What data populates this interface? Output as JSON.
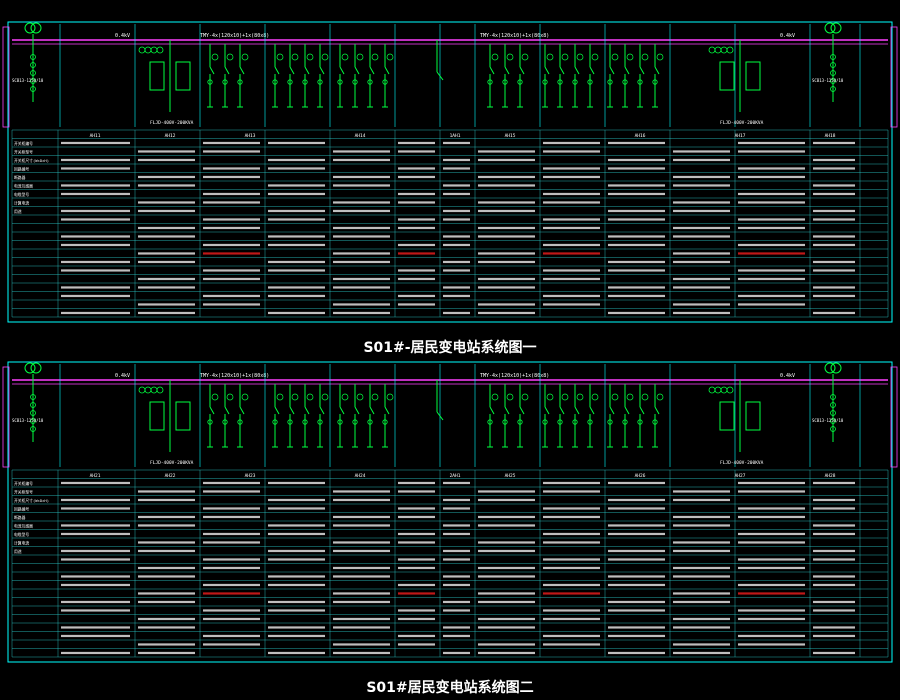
{
  "sheets": [
    {
      "title": "S01#-居民变电站系统图一",
      "bus_left": "0.4kV",
      "bus_mid_left": "TMY-4x(120x10)+1x(80x8)",
      "bus_mid_right": "TMY-4x(120x10)+1x(80x8)",
      "bus_right": "0.4kV",
      "transformer_left": "SCB13-1250/10",
      "transformer_right": "SCB13-1250/10",
      "capacitor_left": "FLJD-400V-200KVA",
      "capacitor_right": "FLJD-400V-200KVA",
      "panels": [
        "AH11",
        "AH12",
        "AH13",
        "AH14",
        "1AH1",
        "AH15",
        "AH16",
        "AH17",
        "AH18"
      ],
      "row_labels": [
        "开关柜编号",
        "开关柜型号",
        "开关柜尺寸(W×D×H)",
        "回路编号",
        "断路器",
        "电流互感器",
        "电缆型号",
        "计算电流",
        "用途"
      ],
      "notes": "说明: 本系统图仅为示意, 具体以设计为准。"
    },
    {
      "title": "S01#居民变电站系统图二",
      "bus_left": "0.4kV",
      "bus_mid_left": "TMY-4x(120x10)+1x(80x8)",
      "bus_mid_right": "TMY-4x(120x10)+1x(80x8)",
      "bus_right": "0.4kV",
      "transformer_left": "SCB13-1250/10",
      "transformer_right": "SCB13-1250/10",
      "capacitor_left": "FLJD-400V-200KVA",
      "capacitor_right": "FLJD-400V-200KVA",
      "panels": [
        "AH21",
        "AH22",
        "AH23",
        "AH24",
        "2AH1",
        "AH25",
        "AH26",
        "AH27",
        "AH28"
      ],
      "row_labels": [
        "开关柜编号",
        "开关柜型号",
        "开关柜尺寸(W×D×H)",
        "回路编号",
        "断路器",
        "电流互感器",
        "电缆型号",
        "计算电流",
        "用途"
      ],
      "notes": ""
    }
  ],
  "colors": {
    "bus": "#ff40ff",
    "frame": "#00ffff",
    "device": "#00ff40",
    "text": "#ffffff",
    "highlight": "#ff2020",
    "grid": "#2fd8d8"
  }
}
